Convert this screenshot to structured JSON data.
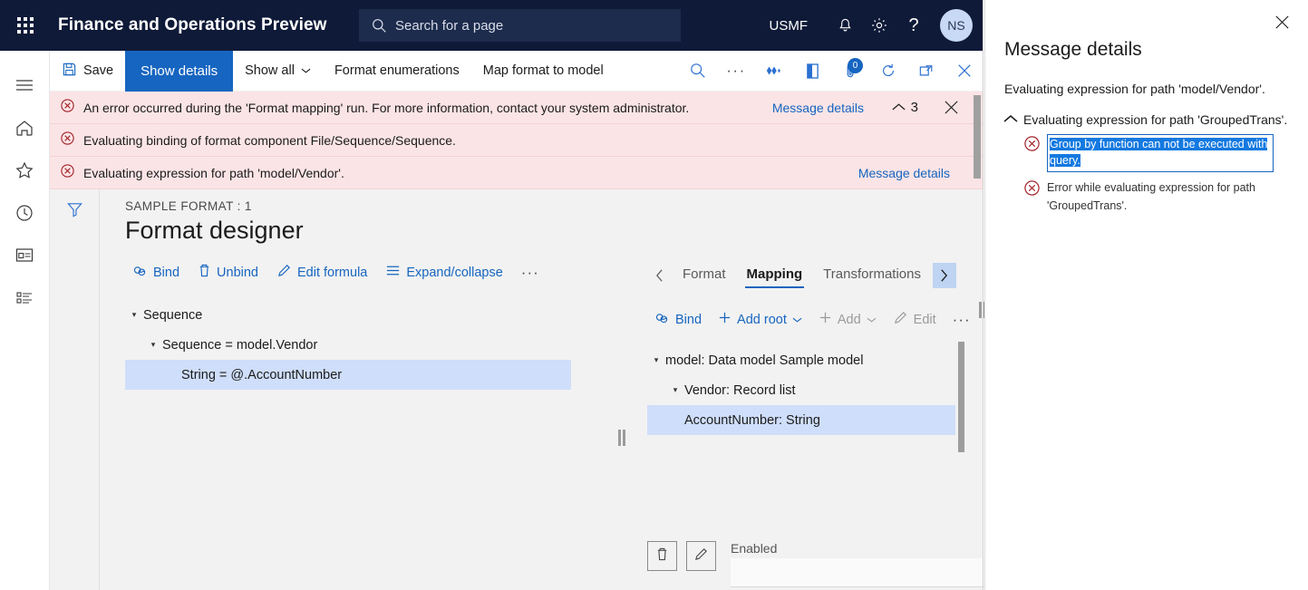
{
  "topbar": {
    "brand": "Finance and Operations Preview",
    "search_placeholder": "Search for a page",
    "company": "USMF",
    "avatar_initials": "NS",
    "icons": {
      "waffle": "app-launcher-icon",
      "search": "search-icon",
      "notifications": "bell-icon",
      "settings": "gear-icon",
      "help": "question-mark-icon"
    },
    "accent": "#0f1a38"
  },
  "rail": {
    "items": [
      {
        "name": "menu-icon",
        "label": "Menu"
      },
      {
        "name": "home-icon",
        "label": "Home"
      },
      {
        "name": "star-icon",
        "label": "Favorites"
      },
      {
        "name": "clock-icon",
        "label": "Recent"
      },
      {
        "name": "workspaces-icon",
        "label": "Workspaces"
      },
      {
        "name": "modules-icon",
        "label": "Modules"
      }
    ]
  },
  "commandbar": {
    "save": "Save",
    "show_details": "Show details",
    "show_all": "Show all",
    "format_enumerations": "Format enumerations",
    "map_format_to_model": "Map format to model",
    "attachment_badge": "0",
    "icons": [
      "search-icon",
      "ellipsis-icon",
      "personalize-icon",
      "office-icon",
      "attachments-icon",
      "refresh-icon",
      "open-in-new-window-icon",
      "close-icon"
    ],
    "primary_color": "#1665c0"
  },
  "errorbar": {
    "rows": [
      {
        "text": "An error occurred during the 'Format mapping' run. For more information, contact your system administrator.",
        "link": "Message details",
        "has_controls": true,
        "count": "3"
      },
      {
        "text": "Evaluating binding of format component File/Sequence/Sequence.",
        "link": "",
        "has_controls": false,
        "count": ""
      },
      {
        "text": "Evaluating expression for path 'model/Vendor'.",
        "link": "Message details",
        "has_controls": false,
        "count": ""
      }
    ],
    "background": "#fbe4e6"
  },
  "page": {
    "breadcrumb": "SAMPLE FORMAT : 1",
    "title": "Format designer",
    "filter_icon": "filter-funnel-icon"
  },
  "format_toolbar": {
    "items": [
      {
        "label": "Bind",
        "icon": "bind-link-icon",
        "disabled": false
      },
      {
        "label": "Unbind",
        "icon": "unbind-trash-icon",
        "disabled": false
      },
      {
        "label": "Edit formula",
        "icon": "pencil-icon",
        "disabled": false
      },
      {
        "label": "Expand/collapse",
        "icon": "list-lines-icon",
        "disabled": false
      }
    ],
    "more": "···"
  },
  "format_tree": [
    {
      "label": "Sequence",
      "indent": 0,
      "expander": true,
      "selected": false
    },
    {
      "label": "Sequence = model.Vendor",
      "indent": 1,
      "expander": true,
      "selected": false
    },
    {
      "label": "String = @.AccountNumber",
      "indent": 2,
      "expander": false,
      "selected": true
    }
  ],
  "mapping": {
    "tabs": [
      {
        "label": "Format",
        "active": false
      },
      {
        "label": "Mapping",
        "active": true
      },
      {
        "label": "Transformations",
        "active": false
      }
    ],
    "nav_prev": "chevron-left-icon",
    "nav_next": "chevron-right-icon",
    "toolbar": [
      {
        "label": "Bind",
        "icon": "bind-link-icon",
        "disabled": false,
        "caret": false
      },
      {
        "label": "Add root",
        "icon": "plus-icon",
        "disabled": false,
        "caret": true
      },
      {
        "label": "Add",
        "icon": "plus-icon",
        "disabled": true,
        "caret": true
      },
      {
        "label": "Edit",
        "icon": "pencil-icon",
        "disabled": true,
        "caret": false
      }
    ],
    "more": "···",
    "tree": [
      {
        "label": "model: Data model Sample model",
        "indent": 0,
        "expander": true,
        "selected": false
      },
      {
        "label": "Vendor: Record list",
        "indent": 1,
        "expander": true,
        "selected": false
      },
      {
        "label": "AccountNumber: String",
        "indent": 2,
        "expander": false,
        "selected": true
      }
    ]
  },
  "bottom": {
    "delete_icon": "trash-icon",
    "edit_icon": "pencil-icon",
    "enabled_label": "Enabled",
    "enabled_value": ""
  },
  "message_panel": {
    "title": "Message details",
    "close_icon": "close-icon",
    "lead": "Evaluating expression for path 'model/Vendor'.",
    "group": {
      "chevron": "chevron-up-icon",
      "text": "Evaluating expression for path 'GroupedTrans'."
    },
    "items": [
      {
        "text": "Group by function can not be executed with query.",
        "selected": true
      },
      {
        "text": "Error while evaluating expression for path 'GroupedTrans'.",
        "selected": false
      }
    ],
    "selection_color": "#1479e0"
  }
}
